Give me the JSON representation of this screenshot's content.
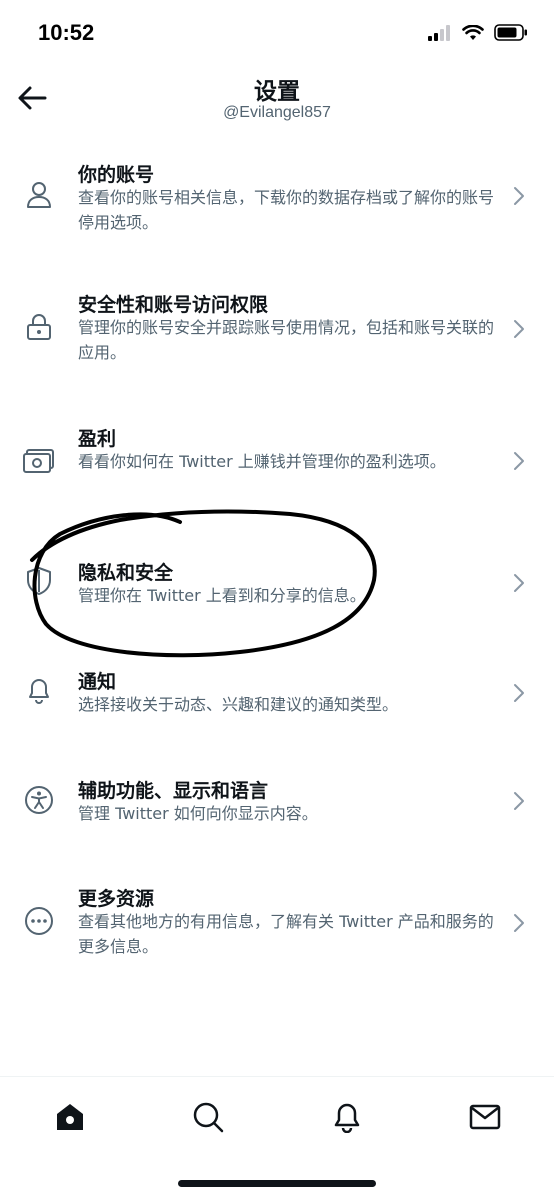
{
  "status_bar": {
    "time": "10:52",
    "icons": [
      "signal-icon",
      "wifi-icon",
      "battery-icon"
    ]
  },
  "header": {
    "back_icon": "arrow-left-icon",
    "title": "设置",
    "subtitle": "@Evilangel857"
  },
  "settings": [
    {
      "icon": "person-icon",
      "title": "你的账号",
      "desc": "查看你的账号相关信息，下载你的数据存档或了解你的账号停用选项。"
    },
    {
      "icon": "lock-icon",
      "title": "安全性和账号访问权限",
      "desc": "管理你的账号安全并跟踪账号使用情况，包括和账号关联的应用。"
    },
    {
      "icon": "money-icon",
      "title": "盈利",
      "desc": "看看你如何在 Twitter 上赚钱并管理你的盈利选项。"
    },
    {
      "icon": "shield-icon",
      "title": "隐私和安全",
      "desc": "管理你在 Twitter 上看到和分享的信息。"
    },
    {
      "icon": "bell-icon",
      "title": "通知",
      "desc": "选择接收关于动态、兴趣和建议的通知类型。"
    },
    {
      "icon": "accessibility-icon",
      "title": "辅助功能、显示和语言",
      "desc": "管理 Twitter 如何向你显示内容。"
    },
    {
      "icon": "more-icon",
      "title": "更多资源",
      "desc": "查看其他地方的有用信息，了解有关 Twitter 产品和服务的更多信息。"
    }
  ],
  "tab_bar": {
    "tabs": [
      "home-icon",
      "search-icon",
      "bell-icon",
      "mail-icon"
    ],
    "active": "home-icon"
  },
  "colors": {
    "text_primary": "#0f1419",
    "text_secondary": "#536471",
    "chevron": "#8b98a5",
    "annotation_ink": "#000000"
  }
}
